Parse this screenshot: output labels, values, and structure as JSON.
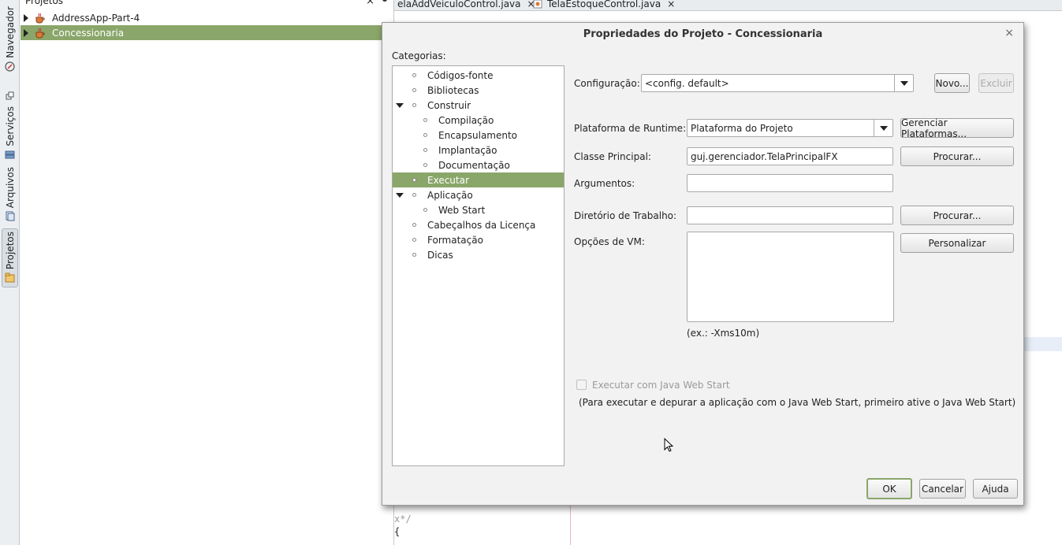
{
  "side_tabs": [
    {
      "label": "Navegador",
      "icon": "navigator-icon"
    },
    {
      "label": "Serviços",
      "icon": "services-icon"
    },
    {
      "label": "Arquivos",
      "icon": "files-icon"
    },
    {
      "label": "Projetos",
      "icon": "projects-icon"
    }
  ],
  "projects_panel": {
    "title": "Projetos",
    "close": "×",
    "items": [
      {
        "label": "AddressApp-Part-4"
      },
      {
        "label": "Concessionaria"
      }
    ]
  },
  "editor": {
    "tabs": [
      {
        "label": "elaAddVeiculoControl.java",
        "close": "×"
      },
      {
        "label": "TelaEstoqueControl.java",
        "close": "×"
      }
    ],
    "code": [
      "x*/",
      "{"
    ]
  },
  "dialog": {
    "title": "Propriedades do Projeto - Concessionaria",
    "close": "×",
    "categories_label": "Categorias:",
    "categories": [
      {
        "label": "Códigos-fonte"
      },
      {
        "label": "Bibliotecas"
      },
      {
        "label": "Construir"
      },
      {
        "label": "Compilação"
      },
      {
        "label": "Encapsulamento"
      },
      {
        "label": "Implantação"
      },
      {
        "label": "Documentação"
      },
      {
        "label": "Executar"
      },
      {
        "label": "Aplicação"
      },
      {
        "label": "Web Start"
      },
      {
        "label": "Cabeçalhos da Licença"
      },
      {
        "label": "Formatação"
      },
      {
        "label": "Dicas"
      }
    ],
    "config": {
      "label": "Configuração:",
      "value": "<config. default>",
      "new_button": "Novo...",
      "delete_button": "Excluir"
    },
    "runtime_platform": {
      "label": "Plataforma de Runtime:",
      "value": "Plataforma do Projeto",
      "manage_button": "Gerenciar Plataformas..."
    },
    "main_class": {
      "label": "Classe Principal:",
      "value": "guj.gerenciador.TelaPrincipalFX",
      "browse_button": "Procurar..."
    },
    "arguments": {
      "label": "Argumentos:",
      "value": ""
    },
    "working_dir": {
      "label": "Diretório de Trabalho:",
      "value": "",
      "browse_button": "Procurar..."
    },
    "vm_options": {
      "label": "Opções de VM:",
      "value": "",
      "customize_button": "Personalizar",
      "hint": "(ex.: -Xms10m)"
    },
    "web_start": {
      "checkbox_label": "Executar com Java Web Start",
      "note": "(Para executar e depurar a aplicação com o Java Web Start, primeiro ative o Java Web Start)"
    },
    "buttons": {
      "ok": "OK",
      "cancel": "Cancelar",
      "help": "Ajuda"
    }
  }
}
